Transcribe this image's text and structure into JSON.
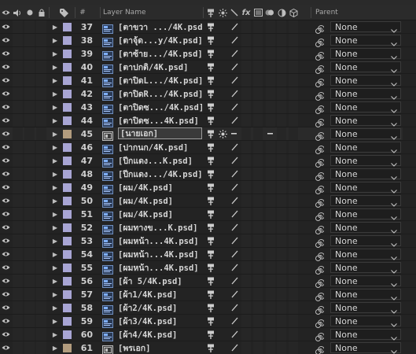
{
  "header": {
    "hash": "#",
    "layer_name": "Layer Name",
    "fx": "fx",
    "parent": "Parent"
  },
  "colors": {
    "lavender": "#a8a5d4",
    "tan": "#b29c7e"
  },
  "layers": [
    {
      "num": "37",
      "name": "[ตาขวา .../4K.psd]",
      "color": "lavender",
      "type": "psd",
      "parent": "None"
    },
    {
      "num": "38",
      "name": "[ตาจุ้ด...y/4K.psd]",
      "color": "lavender",
      "type": "psd",
      "parent": "None"
    },
    {
      "num": "39",
      "name": "[ตาซ้าย.../4K.psd]",
      "color": "lavender",
      "type": "psd",
      "parent": "None"
    },
    {
      "num": "40",
      "name": "[ตาปกติ/4K.psd]",
      "color": "lavender",
      "type": "psd",
      "parent": "None"
    },
    {
      "num": "41",
      "name": "[ตาปิดL.../4K.psd]",
      "color": "lavender",
      "type": "psd",
      "parent": "None"
    },
    {
      "num": "42",
      "name": "[ตาปิดR.../4K.psd]",
      "color": "lavender",
      "type": "psd",
      "parent": "None"
    },
    {
      "num": "43",
      "name": "[ตาปิดซ.../4K.psd]",
      "color": "lavender",
      "type": "psd",
      "parent": "None"
    },
    {
      "num": "44",
      "name": "[ตาปิดซ...4K.psd]",
      "color": "lavender",
      "type": "psd",
      "parent": "None"
    },
    {
      "num": "45",
      "name": "[นายเอก]",
      "color": "tan",
      "type": "comp",
      "parent": "None",
      "selected": true
    },
    {
      "num": "46",
      "name": "[ปากนก/4K.psd]",
      "color": "lavender",
      "type": "psd",
      "parent": "None"
    },
    {
      "num": "47",
      "name": "[ปีกแดง...K.psd]",
      "color": "lavender",
      "type": "psd",
      "parent": "None"
    },
    {
      "num": "48",
      "name": "[ปีกแดง.../4K.psd]",
      "color": "lavender",
      "type": "psd",
      "parent": "None"
    },
    {
      "num": "49",
      "name": "[ผม/4K.psd]",
      "color": "lavender",
      "type": "psd",
      "parent": "None"
    },
    {
      "num": "50",
      "name": "[ผม/4K.psd]",
      "color": "lavender",
      "type": "psd",
      "parent": "None"
    },
    {
      "num": "51",
      "name": "[ผม/4K.psd]",
      "color": "lavender",
      "type": "psd",
      "parent": "None"
    },
    {
      "num": "52",
      "name": "[ผมทางข...K.psd]",
      "color": "lavender",
      "type": "psd",
      "parent": "None"
    },
    {
      "num": "53",
      "name": "[ผมหน้า...4K.psd]",
      "color": "lavender",
      "type": "psd",
      "parent": "None"
    },
    {
      "num": "54",
      "name": "[ผมหน้า...4K.psd]",
      "color": "lavender",
      "type": "psd",
      "parent": "None"
    },
    {
      "num": "55",
      "name": "[ผมหน้า...4K.psd]",
      "color": "lavender",
      "type": "psd",
      "parent": "None"
    },
    {
      "num": "56",
      "name": "[ผ้า 5/4K.psd]",
      "color": "lavender",
      "type": "psd",
      "parent": "None"
    },
    {
      "num": "57",
      "name": "[ผ้า1/4K.psd]",
      "color": "lavender",
      "type": "psd",
      "parent": "None"
    },
    {
      "num": "58",
      "name": "[ผ้า2/4K.psd]",
      "color": "lavender",
      "type": "psd",
      "parent": "None"
    },
    {
      "num": "59",
      "name": "[ผ้า3/4K.psd]",
      "color": "lavender",
      "type": "psd",
      "parent": "None"
    },
    {
      "num": "60",
      "name": "[ผ้า4/4K.psd]",
      "color": "lavender",
      "type": "psd",
      "parent": "None"
    },
    {
      "num": "61",
      "name": "[พรเอก]",
      "color": "tan",
      "type": "comp",
      "parent": "None"
    }
  ]
}
